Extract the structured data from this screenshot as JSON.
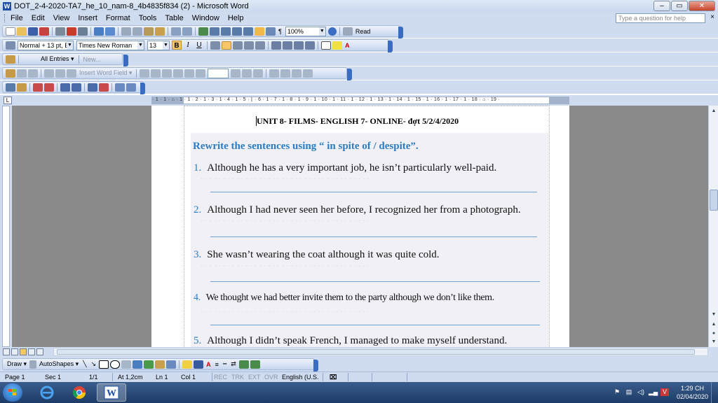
{
  "window": {
    "title": "DOT_2-4-2020-TA7_he_10_nam-8_4b4835f834 (2) - Microsoft Word",
    "controls": [
      "–",
      "▭",
      "✕"
    ]
  },
  "menu": {
    "items": [
      "File",
      "Edit",
      "View",
      "Insert",
      "Format",
      "Tools",
      "Table",
      "Window",
      "Help"
    ],
    "help_placeholder": "Type a question for help",
    "close": "×"
  },
  "standard_toolbar": {
    "zoom": "100%",
    "read_label": "Read"
  },
  "formatting_toolbar": {
    "style": "Normal + 13 pt, E",
    "font": "Times New Roman",
    "size": "13",
    "bold": "B",
    "italic": "I",
    "underline": "U",
    "highlight_letter": "A"
  },
  "autotext_toolbar": {
    "all_entries": "All Entries ▾",
    "new": "New..."
  },
  "mailmerge_toolbar": {
    "insert_word_field": "Insert Word Field ▾"
  },
  "ruler": {
    "corner": "L",
    "marks": "· 1 · 1 · ⌂ · 1 · 1 · 2 · 1 · 3 · 1 · 4 · 1 · 5 · ⌊ · 6 · 1 · 7 · 1 · 8 · 1 · 9 · 1 · 10 · 1 · 11 · 1 · 12 · 1 · 13 · 1 · 14 · 1 · 15 · 1 · 16 · 1 · 17 · 1 · 18 · ⌂ · 19 ·"
  },
  "document": {
    "heading": "UNIT 8- FILMS- ENGLISH 7- ONLINE- đợt 5/2/4/2020",
    "instruction": "Rewrite the sentences using “ in spite of / despite”.",
    "items": [
      {
        "num": "1.",
        "text": "Although he has a very important job, he isn’t particularly well-paid."
      },
      {
        "num": "2.",
        "text": "Although I had never seen her before, I recognized her from a photograph."
      },
      {
        "num": "3.",
        "text": "She wasn’t wearing the coat although it was quite cold."
      },
      {
        "num": "4.",
        "text": "We thought we had better invite them to the party although we don’t like them."
      },
      {
        "num": "5.",
        "text": "Although I didn’t speak French, I managed to make myself understand."
      }
    ]
  },
  "draw_toolbar": {
    "draw": "Draw ▾",
    "autoshapes": "AutoShapes ▾"
  },
  "status": {
    "page": "Page 1",
    "sec": "Sec 1",
    "pages": "1/1",
    "at": "At 1,2cm",
    "ln": "Ln 1",
    "col": "Col 1",
    "rec": "REC",
    "trk": "TRK",
    "ext": "EXT",
    "ovr": "OVR",
    "language": "English (U.S."
  },
  "taskbar": {
    "time": "1:29 CH",
    "date": "02/04/2020"
  },
  "colors": {
    "accent_blue": "#2a7cc6",
    "toolbar_bg": "#cfdcf0",
    "taskbar_bg": "#1d3b66"
  }
}
